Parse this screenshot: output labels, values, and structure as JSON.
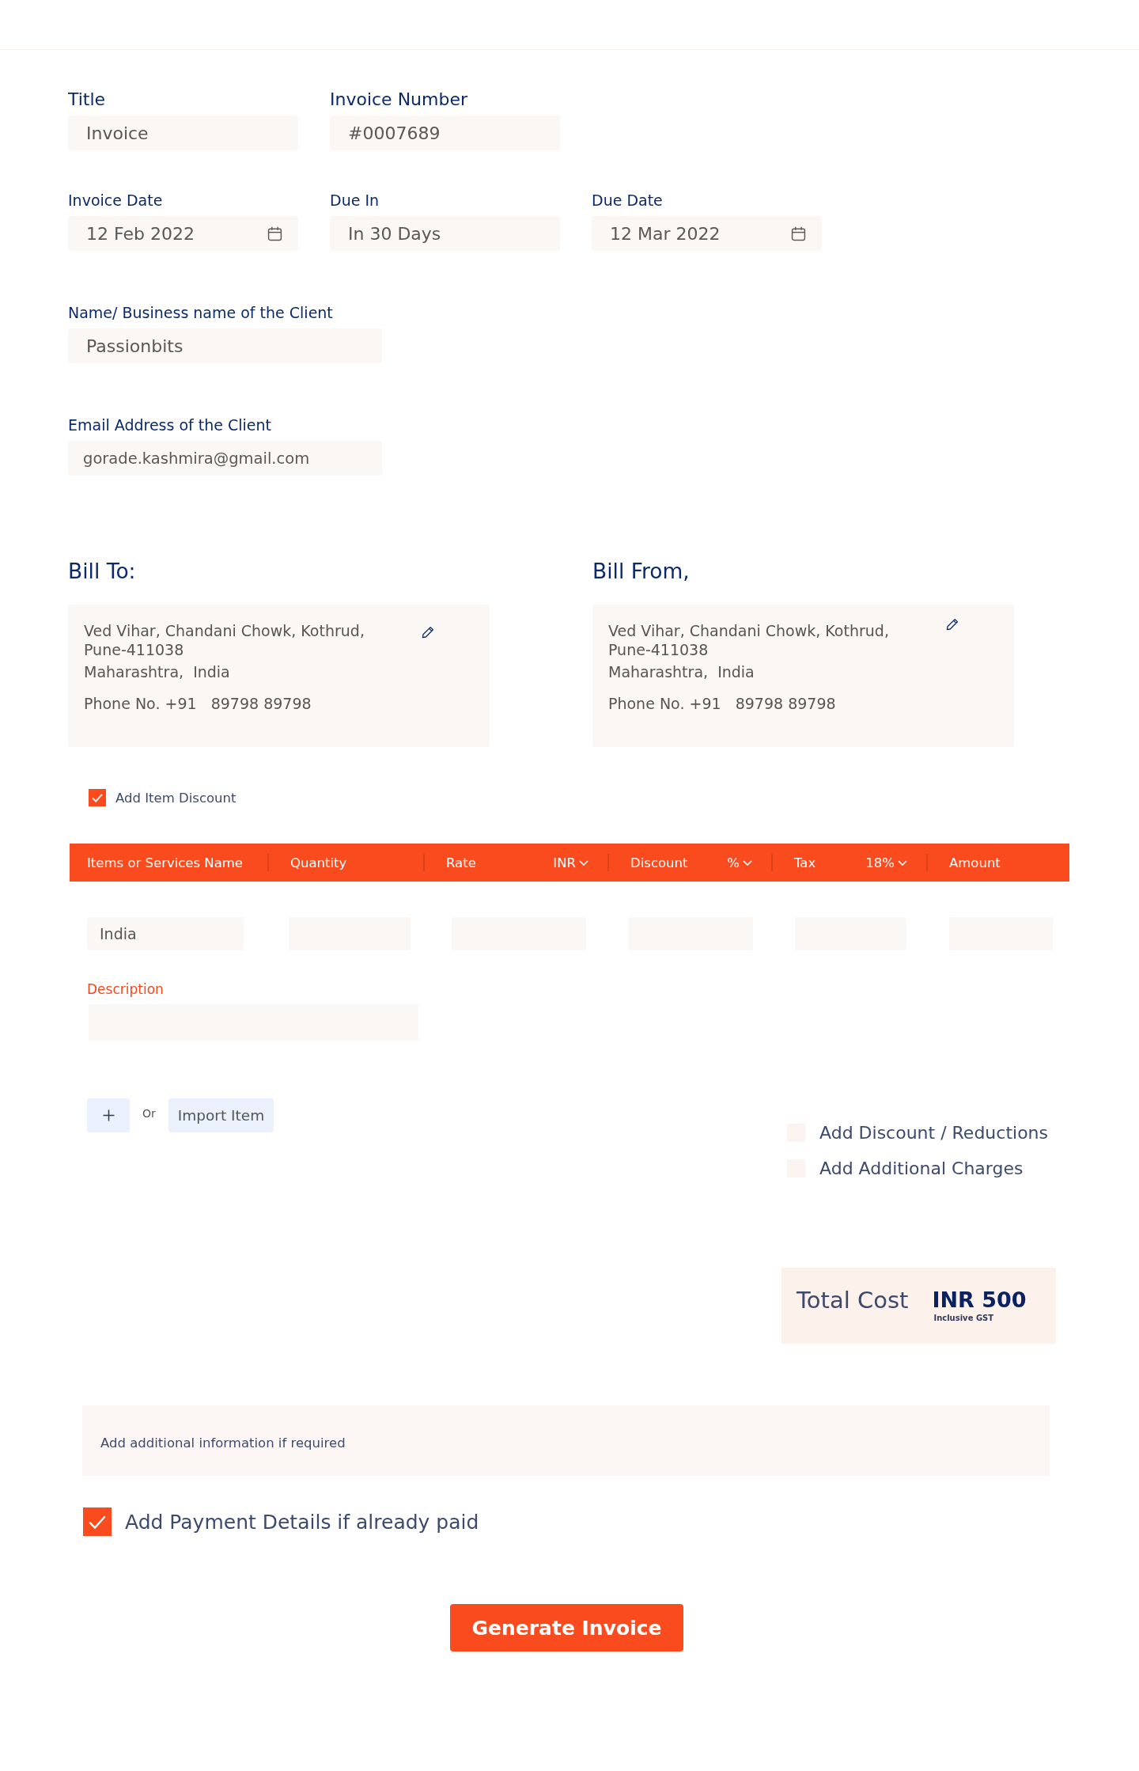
{
  "form_fields": [
    [
      {
        "label": "Title",
        "value": "Invoice",
        "kind": "text"
      },
      {
        "label": "Invoice Number",
        "value": "#0007689",
        "kind": "text"
      }
    ],
    [
      {
        "label": "Invoice Date",
        "value": "12 Feb 2022",
        "kind": "date"
      },
      {
        "label": "Due In",
        "value": "In 30 Days",
        "kind": "text"
      },
      {
        "label": "Due Date",
        "value": "12 Mar 2022",
        "kind": "date"
      }
    ],
    [
      {
        "label": "Name/ Business name of the Client",
        "value": "Passionbits",
        "kind": "text"
      }
    ],
    [
      {
        "label": "Email Address of the Client",
        "value": "gorade.kashmira@gmail.com",
        "kind": "email"
      }
    ]
  ],
  "billing": [
    {
      "heading": "Bill To:",
      "address_lines": [
        "Ved Vihar, Chandani Chowk, Kothrud,",
        "Pune-411038",
        "Maharashtra,  India"
      ],
      "phone": "Phone No. +91   89798 89798"
    },
    {
      "heading": "Bill From,",
      "address_lines": [
        "Ved Vihar, Chandani Chowk, Kothrud,",
        "Pune-411038",
        "Maharashtra,  India"
      ],
      "phone": "Phone No. +91   89798 89798"
    }
  ],
  "item_discount": {
    "label": "Add Item Discount",
    "checked": true
  },
  "items_table": {
    "columns": [
      {
        "label": "Items or Services Name"
      },
      {
        "label": "Quantity"
      },
      {
        "label": "Rate",
        "unit": "INR"
      },
      {
        "label": "Discount",
        "unit": "%"
      },
      {
        "label": "Tax",
        "unit": "18%"
      },
      {
        "label": "Amount"
      }
    ],
    "rows": [
      {
        "values": [
          "India"
        ]
      }
    ]
  },
  "description": {
    "label": "Description"
  },
  "add_item": {
    "or_text": "Or",
    "import_button": "Import Item"
  },
  "extra_options": [
    {
      "label": "Add Discount / Reductions",
      "checked": false
    },
    {
      "label": "Add Additional Charges",
      "checked": false
    }
  ],
  "total": {
    "label": "Total Cost",
    "amount": "INR 500",
    "note": "Inclusive GST"
  },
  "notes": {
    "placeholder": "Add additional information if required"
  },
  "payment_details": {
    "label": "Add Payment Details if already paid",
    "checked": true
  },
  "generate_button": {
    "label": "Generate Invoice"
  }
}
